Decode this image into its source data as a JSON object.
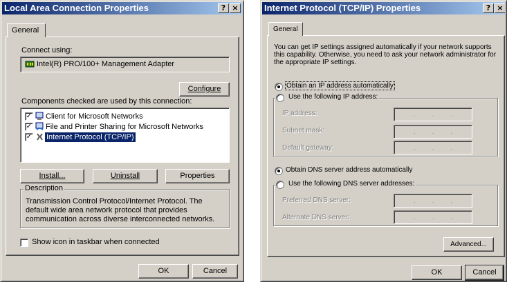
{
  "left_dialog": {
    "title": "Local Area Connection Properties",
    "help_btn": "?",
    "close_btn": "×",
    "tab": "General",
    "connect_using_label": "Connect using:",
    "adapter_name": "Intel(R) PRO/100+ Management Adapter",
    "configure_btn": "Configure",
    "components_label": "Components checked are used by this connection:",
    "components": [
      {
        "label": "Client for Microsoft Networks",
        "checked": true,
        "selected": false
      },
      {
        "label": "File and Printer Sharing for Microsoft Networks",
        "checked": true,
        "selected": false
      },
      {
        "label": "Internet Protocol (TCP/IP)",
        "checked": true,
        "selected": true
      }
    ],
    "install_btn": "Install...",
    "uninstall_btn": "Uninstall",
    "properties_btn": "Properties",
    "description_legend": "Description",
    "description_text": "Transmission Control Protocol/Internet Protocol. The default wide area network protocol that provides communication across diverse interconnected networks.",
    "show_icon_label": "Show icon in taskbar when connected",
    "ok_btn": "OK",
    "cancel_btn": "Cancel"
  },
  "right_dialog": {
    "title": "Internet Protocol (TCP/IP) Properties",
    "help_btn": "?",
    "close_btn": "×",
    "tab": "General",
    "intro_text": "You can get IP settings assigned automatically if your network supports this capability. Otherwise, you need to ask your network administrator for the appropriate IP settings.",
    "obtain_ip_auto": "Obtain an IP address automatically",
    "use_following_ip": "Use the following IP address:",
    "ip_address_label": "IP address:",
    "subnet_mask_label": "Subnet mask:",
    "default_gateway_label": "Default gateway:",
    "obtain_dns_auto": "Obtain DNS server address automatically",
    "use_following_dns": "Use the following DNS server addresses:",
    "preferred_dns_label": "Preferred DNS server:",
    "alternate_dns_label": "Alternate DNS server:",
    "ip_dot": ".",
    "advanced_btn": "Advanced...",
    "ok_btn": "OK",
    "cancel_btn": "Cancel"
  }
}
